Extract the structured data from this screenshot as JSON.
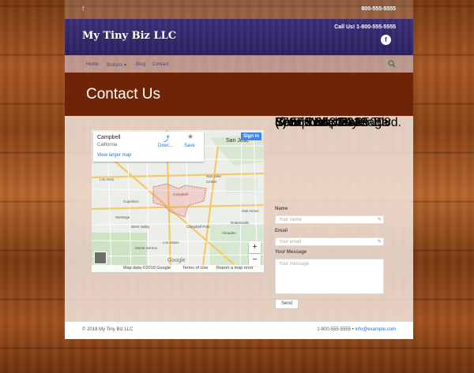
{
  "topbar": {
    "facebook_icon": "facebook-icon",
    "phone": "800-555-5555"
  },
  "header": {
    "brand": "My Tiny Biz LLC",
    "call_us": "Call Us! 1-800-555-5555",
    "facebook_glyph": "f"
  },
  "nav": {
    "items": [
      {
        "label": "Home"
      },
      {
        "label": "Buttons"
      },
      {
        "label": "Blog"
      },
      {
        "label": "Contact"
      }
    ],
    "dropdown_glyph": "▾",
    "search_icon": "search-icon"
  },
  "hero": {
    "title": "Contact Us"
  },
  "map": {
    "place_name": "Campbell",
    "place_region": "California",
    "directions_label": "Direc...",
    "save_label": "Save",
    "larger_map_link": "View larger map",
    "sign_in": "Sign in",
    "zoom_in": "+",
    "zoom_out": "−",
    "google_logo": "Google",
    "attribution": "Map data ©2018 Google",
    "terms": "Terms of Use",
    "report": "Report a map error",
    "labels": {
      "san_jose": "San Jose",
      "campbell": "Campbell",
      "cupertino": "Cupertino",
      "saratoga": "Saratoga",
      "los_gatos": "Los Gatos",
      "monte_sereno": "Monte Sereno",
      "campbell_park": "Campbell Park",
      "los_altos": "Los Altos",
      "west_valley": "West Valley",
      "robertsville": "Robertsville",
      "almaden": "Almaden",
      "sun_jose": "Sun Jose",
      "center": "Center",
      "oak_grove": "Oak Grove"
    }
  },
  "company": {
    "name": "Your Company",
    "address1": "8787 Winchester Blvd.",
    "address2": "Campbell, CA 95008",
    "tel": "(t) 555.353.5343",
    "fax": "(f) 555.343.2222"
  },
  "form": {
    "title": "Send Us a Message",
    "name_label": "Name",
    "name_placeholder": "Your name",
    "email_label": "Email",
    "email_placeholder": "Your email",
    "message_label": "Your Message",
    "message_placeholder": "Your message",
    "send_label": "Send"
  },
  "footer": {
    "copyright": "© 2018 My Tiny Biz LLC",
    "phone": "1-800-555-5555",
    "separator": "•",
    "email": "info@example.com"
  },
  "colors": {
    "header_purple": "#2c2163",
    "hero_brown": "#6e2406",
    "link_blue": "#1a73e8"
  }
}
